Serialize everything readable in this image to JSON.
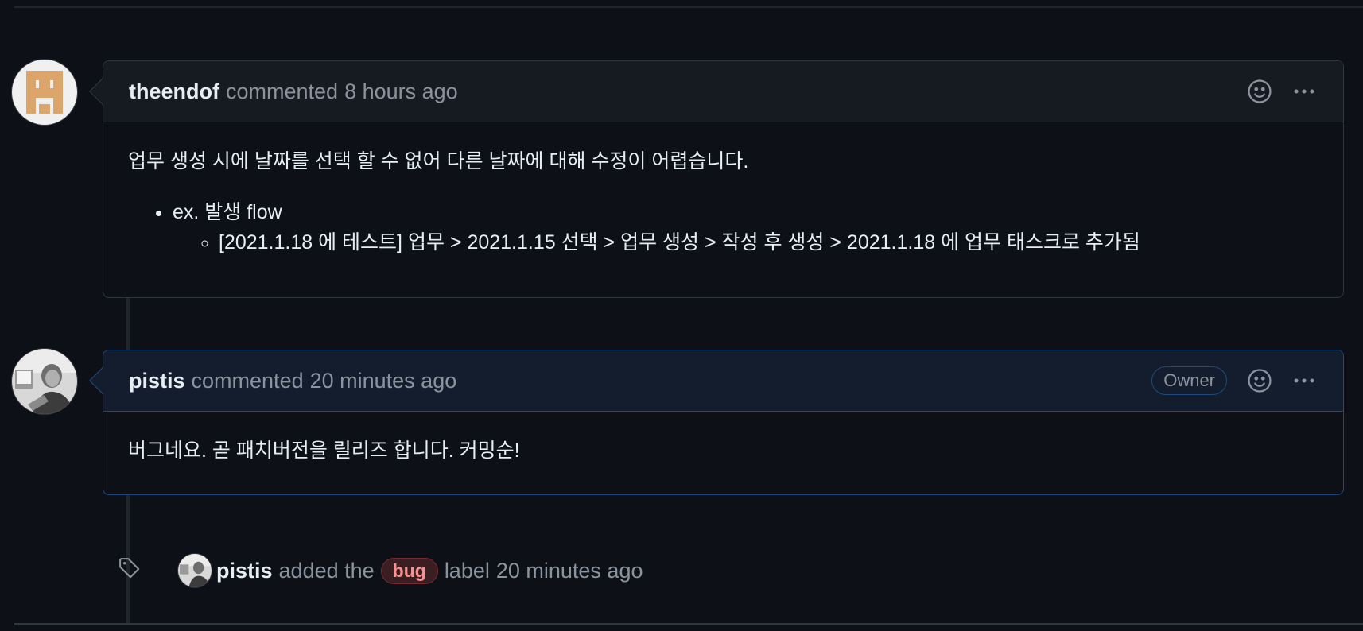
{
  "comments": [
    {
      "author": "theendof",
      "action": "commented",
      "time": "8 hours ago",
      "body_text": "업무 생성 시에 날짜를 선택 할 수 없어 다른 날짜에 대해 수정이 어렵습니다.",
      "list_item": "ex. 발생 flow",
      "sub_item": "[2021.1.18 에 테스트] 업무 > 2021.1.15 선택 > 업무 생성 > 작성 후 생성 > 2021.1.18 에 업무 태스크로 추가됨"
    },
    {
      "author": "pistis",
      "action": "commented",
      "time": "20 minutes ago",
      "badge": "Owner",
      "body_text": "버그네요. 곧 패치버전을 릴리즈 합니다. 커밍순!"
    }
  ],
  "event": {
    "actor": "pistis",
    "text_before": "added the",
    "label": "bug",
    "text_after": "label",
    "time": "20 minutes ago"
  },
  "icons": {
    "comment_reaction": "smiley-icon",
    "comment_menu": "kebab-menu-icon",
    "event": "tag-icon"
  },
  "colors": {
    "background": "#0d1117",
    "owner_border": "#1f4a7e",
    "bug_label": "#ff8f8f"
  }
}
